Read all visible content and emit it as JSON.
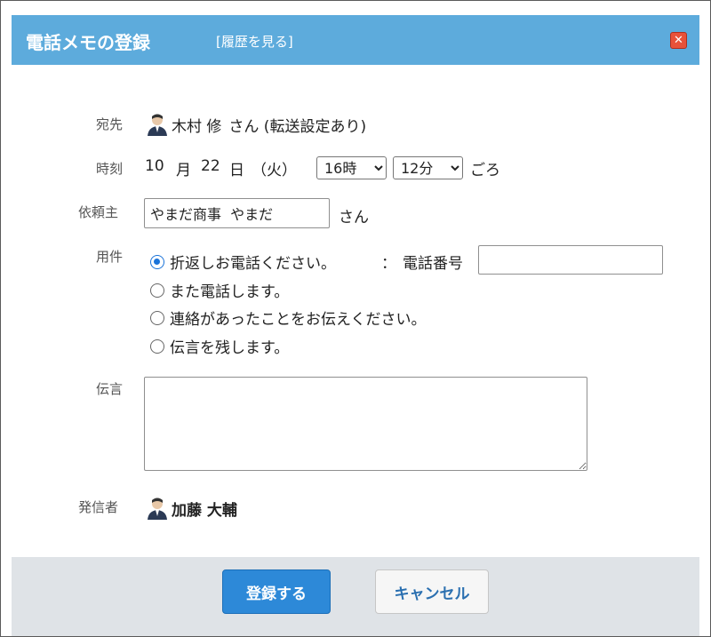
{
  "dialog": {
    "title": "電話メモの登録",
    "history_link": "[履歴を見る]",
    "close_symbol": "✕"
  },
  "form": {
    "recipient": {
      "label": "宛先",
      "name": "木村 修",
      "suffix": "さん (転送設定あり)"
    },
    "time": {
      "label": "時刻",
      "month": "10",
      "month_unit": "月",
      "day": "22",
      "day_unit": "日",
      "weekday": "（火）",
      "hour_selected": "16時",
      "minute_selected": "12分",
      "suffix": "ごろ"
    },
    "requester": {
      "label": "依頼主",
      "value": "やまだ商事  やまだ",
      "suffix": "さん"
    },
    "purpose": {
      "label": "用件",
      "options": [
        {
          "label": "折返しお電話ください。",
          "checked": true
        },
        {
          "label": "また電話します。",
          "checked": false
        },
        {
          "label": "連絡があったことをお伝えください。",
          "checked": false
        },
        {
          "label": "伝言を残します。",
          "checked": false
        }
      ],
      "phone_sep": "：",
      "phone_label": "電話番号",
      "phone_value": ""
    },
    "message": {
      "label": "伝言",
      "value": ""
    },
    "sender": {
      "label": "発信者",
      "name": "加藤 大輔"
    }
  },
  "buttons": {
    "submit": "登録する",
    "cancel": "キャンセル"
  },
  "colors": {
    "header": "#5dabdc",
    "primary": "#2d89d8",
    "footer": "#dfe3e7",
    "radio": "#1a73d9"
  }
}
